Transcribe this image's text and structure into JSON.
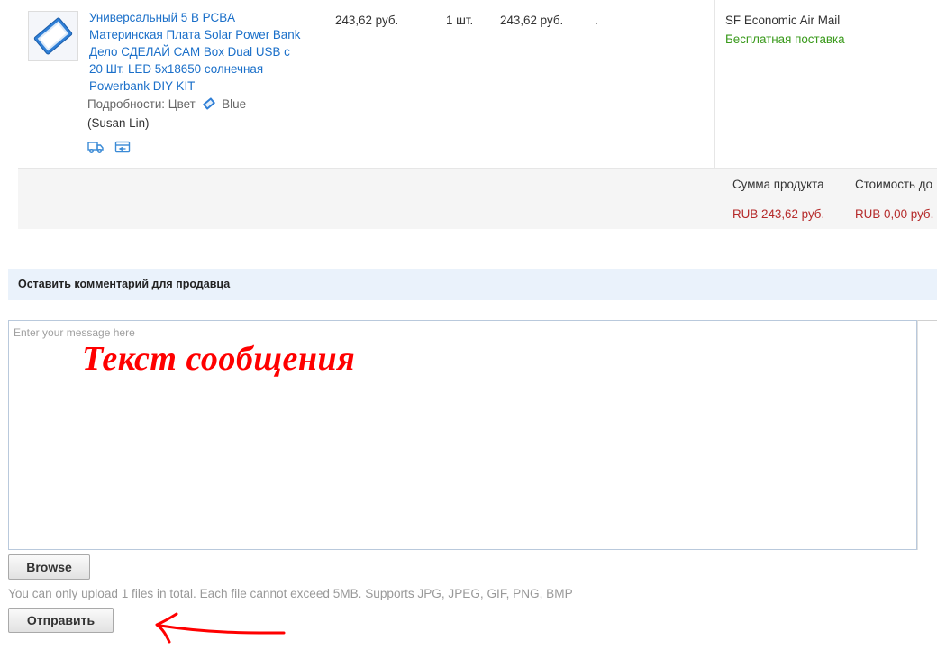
{
  "order": {
    "product_title": "Универсальный 5 В PCBA Материнская Плата Solar Power Bank Дело СДЕЛАЙ САМ Box Dual USB с 20 Шт. LED 5x18650 солнечная Powerbank DIY KIT",
    "details_label": "Подробности:",
    "color_label": "Цвет",
    "color_value": "Blue",
    "seller": "(Susan Lin)",
    "price": "243,62 руб.",
    "quantity": "1 шт.",
    "total": "243,62 руб.",
    "dot": ".",
    "shipping_method": "SF Economic Air Mail",
    "shipping_cost": "Бесплатная поставка",
    "icons": [
      "image-icon",
      "truck-icon",
      "card-icon",
      "color-swatch-icon"
    ]
  },
  "summary": {
    "product_sum_label": "Сумма продукта",
    "product_sum_value": "RUB 243,62 руб.",
    "shipping_cost_label": "Стоимость до",
    "shipping_cost_value": "RUB 0,00 руб."
  },
  "comment": {
    "heading": "Оставить комментарий для продавца",
    "placeholder": "Enter your message here",
    "annotation": "Текст сообщения",
    "browse_label": "Browse",
    "upload_hint": "You can only upload 1 files in total. Each file cannot exceed 5MB. Supports JPG, JPEG, GIF, PNG, BMP",
    "send_label": "Отправить"
  },
  "colors": {
    "link": "#1a6fc9",
    "free_shipping": "#3a9a1c",
    "price_red": "#b52a2a",
    "annotation_red": "#ff0000",
    "header_bg": "#eaf2fb"
  }
}
